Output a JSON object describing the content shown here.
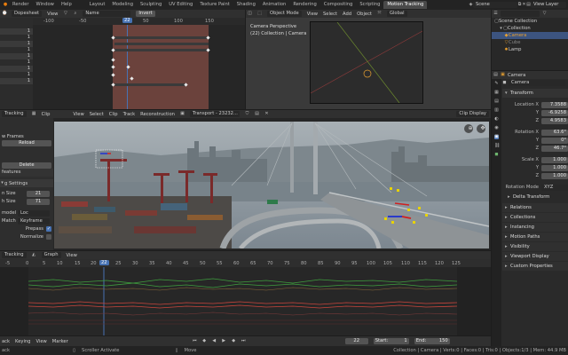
{
  "topbar": {
    "menus": [
      "Render",
      "Window",
      "Help"
    ],
    "workspaces": [
      "Layout",
      "Modeling",
      "Sculpting",
      "UV Editing",
      "Texture Paint",
      "Shading",
      "Animation",
      "Rendering",
      "Compositing",
      "Scripting",
      "Motion Tracking"
    ],
    "active_workspace": "Motion Tracking",
    "scene": "Scene",
    "view_layer": "View Layer"
  },
  "dopesheet": {
    "mode": "Dopesheet",
    "view": "View",
    "name_field": "Name",
    "invert": "Invert",
    "ruler": [
      "-100",
      "-50",
      "22",
      "50",
      "100",
      "150"
    ],
    "current_frame": "22",
    "rows": [
      "1",
      "1",
      "1",
      "1",
      "1",
      "1",
      "1",
      "1",
      "1"
    ]
  },
  "viewport3d": {
    "mode": "Object Mode",
    "menus": [
      "View",
      "Select",
      "Add",
      "Object"
    ],
    "orientation": "Global",
    "info_line1": "Camera Perspective",
    "info_line2": "(22) Collection | Camera"
  },
  "outliner": {
    "root": "Scene Collection",
    "collection": "Collection",
    "items": [
      "Camera",
      "Cube",
      "Lamp"
    ]
  },
  "clip_editor": {
    "mode": "Tracking",
    "clip_label": "Clip",
    "menus": [
      "View",
      "Select",
      "Clip",
      "Track",
      "Reconstruction"
    ],
    "clip_name": "Transport - 23232...",
    "display": "Clip Display"
  },
  "tool_panel": {
    "frames_label": "w Frames",
    "reload": "Reload",
    "delete": "Delete",
    "features": "features",
    "settings": "g Settings",
    "pattern_size_label": "n Size",
    "pattern_size": "21",
    "search_size_label": "h Size",
    "search_size": "71",
    "motion_model_label": "model",
    "motion_model": "Loc",
    "match_label": "Match",
    "match": "Keyframe",
    "prepass": "Prepass",
    "normalize": "Normalize"
  },
  "graph": {
    "mode": "Tracking",
    "type": "Graph",
    "view": "View",
    "ruler": [
      "-5",
      "0",
      "5",
      "10",
      "15",
      "20",
      "22",
      "25",
      "30",
      "35",
      "40",
      "45",
      "50",
      "55",
      "60",
      "65",
      "70",
      "75",
      "80",
      "85",
      "90",
      "95",
      "100",
      "105",
      "110",
      "115",
      "120",
      "125"
    ],
    "current_frame": "22"
  },
  "timeline": {
    "menus": [
      "ack",
      "Keying",
      "View",
      "Marker"
    ],
    "current_frame": "22",
    "start_label": "Start:",
    "start": "1",
    "end_label": "End:",
    "end": "150"
  },
  "properties": {
    "object": "Camera",
    "data_name": "Camera",
    "transform": "Transform",
    "location_label": "Location X",
    "location": [
      "7.3588",
      "-6.9258",
      "4.9583"
    ],
    "rotation_label": "Rotation X",
    "rotation": [
      "63.6°",
      "0°",
      "46.7°"
    ],
    "scale_label": "Scale X",
    "scale": [
      "1.000",
      "1.000",
      "1.000"
    ],
    "axis_y": "Y",
    "axis_z": "Z",
    "rotation_mode_label": "Rotation Mode",
    "rotation_mode": "XYZ Euler",
    "delta_transform": "Delta Transform",
    "sections": [
      "Relations",
      "Collections",
      "Instancing",
      "Motion Paths",
      "Visibility",
      "Viewport Display",
      "Custom Properties"
    ]
  },
  "statusbar": {
    "left": "ack",
    "scroller": "Scroller Activate",
    "move": "Move",
    "stats": "Collection | Camera | Verts:0 | Faces:0 | Tris:0 | Objects:1/3 | Mem: 44.9 MB"
  },
  "colors": {
    "accent": "#4772b3",
    "keyframe_bg": "#6b423c",
    "marker_yellow": "#e8d300",
    "curve_red": "#c8453c",
    "curve_green": "#3e9e3e"
  }
}
